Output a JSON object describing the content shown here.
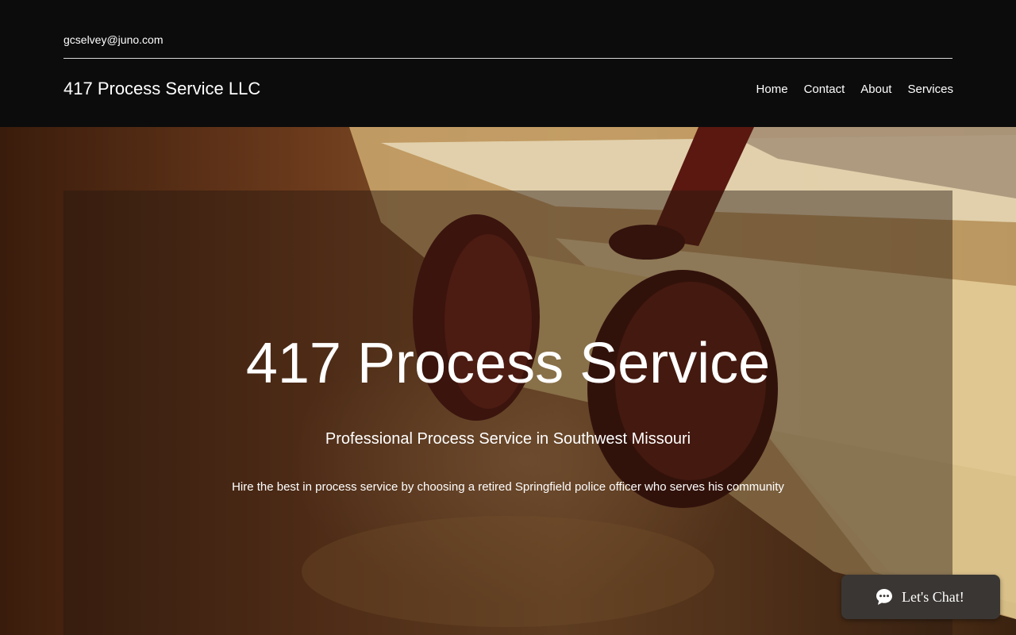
{
  "header": {
    "email": "gcselvey@juno.com",
    "site_title": "417 Process Service LLC",
    "nav": [
      {
        "label": "Home"
      },
      {
        "label": "Contact"
      },
      {
        "label": "About"
      },
      {
        "label": "Services"
      }
    ]
  },
  "hero": {
    "title": "417 Process Service",
    "subtitle": "Professional Process Service in Southwest Missouri",
    "description": "Hire the best in process service by choosing a retired Springfield police officer who serves his community",
    "background_image": "gavel-on-books-icon"
  },
  "chat_widget": {
    "label": "Let's Chat!",
    "icon": "chat-bubble-icon"
  },
  "colors": {
    "header_bg": "#0c0c0c",
    "text": "#ffffff",
    "chat_bg": "#3a3633"
  }
}
